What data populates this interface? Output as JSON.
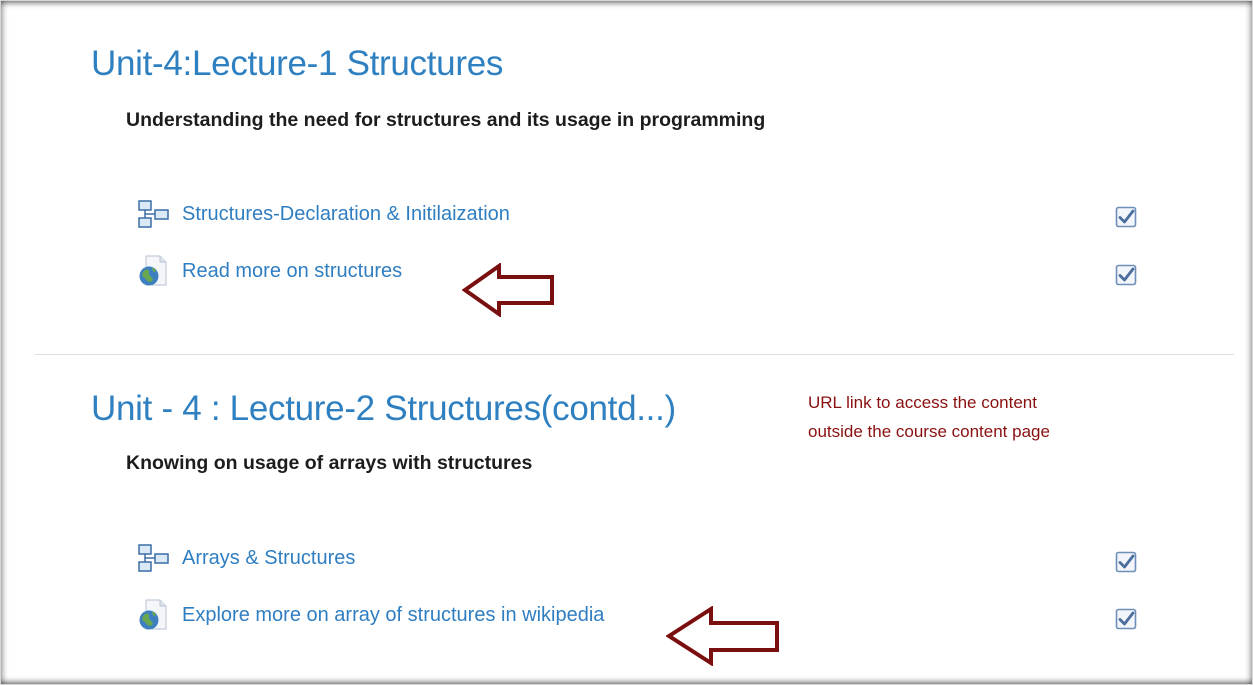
{
  "sections": [
    {
      "title": "Unit-4:Lecture-1 Structures",
      "summary": "Understanding the need for structures and its usage in programming",
      "activities": [
        {
          "label": "Structures-Declaration & Initilaization",
          "icon": "book-icon",
          "completed": true
        },
        {
          "label": "Read more on structures",
          "icon": "url-globe-icon",
          "completed": true
        }
      ]
    },
    {
      "title": "Unit - 4 : Lecture-2 Structures(contd...)",
      "summary": "Knowing on usage of arrays with structures",
      "activities": [
        {
          "label": "Arrays & Structures",
          "icon": "book-icon",
          "completed": true
        },
        {
          "label": "Explore more on array of structures in wikipedia",
          "icon": "url-globe-icon",
          "completed": true
        }
      ]
    }
  ],
  "annotation": {
    "lines": [
      "URL link to access the content",
      "outside the course content page"
    ],
    "color": "#8a1010"
  },
  "colors": {
    "link": "#2f7ec1",
    "title": "#2f80c0",
    "arrow": "#7a0f0f",
    "checkbox": "#6f8fb8"
  }
}
